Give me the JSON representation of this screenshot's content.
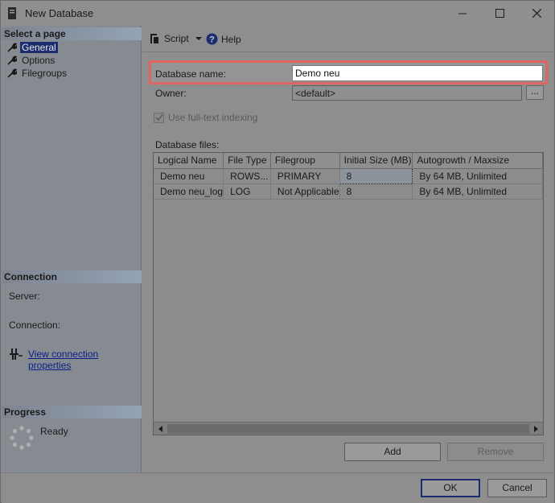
{
  "window": {
    "title": "New Database"
  },
  "left_panel": {
    "select_page_header": "Select a page",
    "pages": [
      {
        "label": "General",
        "selected": true
      },
      {
        "label": "Options",
        "selected": false
      },
      {
        "label": "Filegroups",
        "selected": false
      }
    ],
    "connection_header": "Connection",
    "server_label": "Server:",
    "connection_label": "Connection:",
    "view_connection_link": "View connection properties",
    "progress_header": "Progress",
    "progress_status": "Ready"
  },
  "toolbar": {
    "script_label": "Script",
    "help_label": "Help"
  },
  "form": {
    "database_name_label": "Database name:",
    "database_name_value": "Demo neu",
    "owner_label": "Owner:",
    "owner_value": "<default>",
    "owner_browse_label": "...",
    "fulltext_label": "Use full-text indexing",
    "fulltext_checked": true,
    "database_files_label": "Database files:"
  },
  "files_grid": {
    "columns": [
      "Logical Name",
      "File Type",
      "Filegroup",
      "Initial Size (MB)",
      "Autogrowth / Maxsize"
    ],
    "rows": [
      [
        "Demo neu",
        "ROWS...",
        "PRIMARY",
        "8",
        "By 64 MB, Unlimited"
      ],
      [
        "Demo neu_log",
        "LOG",
        "Not Applicable",
        "8",
        "By 64 MB, Unlimited"
      ]
    ]
  },
  "grid_buttons": {
    "add_label": "Add",
    "remove_label": "Remove"
  },
  "footer": {
    "ok_label": "OK",
    "cancel_label": "Cancel"
  }
}
